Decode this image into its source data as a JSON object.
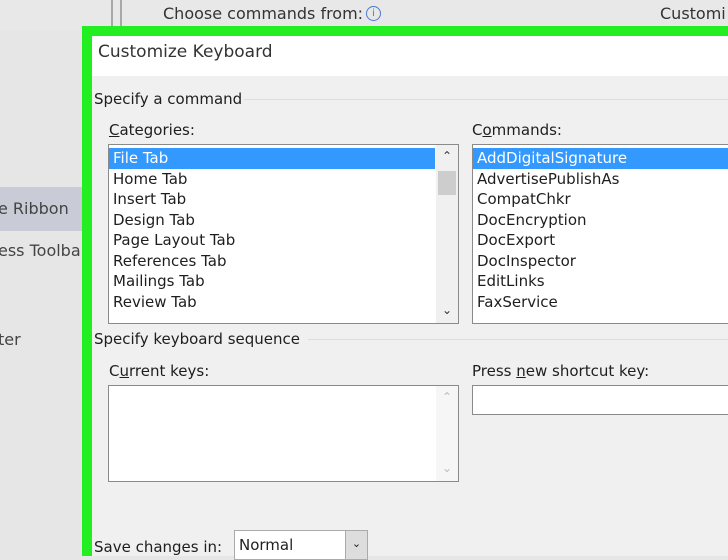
{
  "background": {
    "choose_commands_label": "Choose commands from:",
    "customize_label": "Customi",
    "sidebar": [
      "e Ribbon",
      "ess Toolba",
      "ter"
    ]
  },
  "dialog": {
    "title": "Customize Keyboard",
    "specify_command": "Specify a command",
    "categories_label": {
      "pre": "",
      "key": "C",
      "post": "ategories:"
    },
    "commands_label": {
      "pre": "C",
      "key": "o",
      "post": "mmands:"
    },
    "categories": [
      "File Tab",
      "Home Tab",
      "Insert Tab",
      "Design Tab",
      "Page Layout Tab",
      "References Tab",
      "Mailings Tab",
      "Review Tab"
    ],
    "commands": [
      "AddDigitalSignature",
      "AdvertisePublishAs",
      "CompatChkr",
      "DocEncryption",
      "DocExport",
      "DocInspector",
      "EditLinks",
      "FaxService"
    ],
    "specify_sequence": "Specify keyboard sequence",
    "current_keys_label": {
      "pre": "C",
      "key": "u",
      "post": "rrent keys:"
    },
    "new_key_label": {
      "pre": "Press ",
      "key": "n",
      "post": "ew shortcut key:"
    },
    "new_key_value": "",
    "save_changes_label": "Save changes in:",
    "save_changes_value": "Normal"
  }
}
